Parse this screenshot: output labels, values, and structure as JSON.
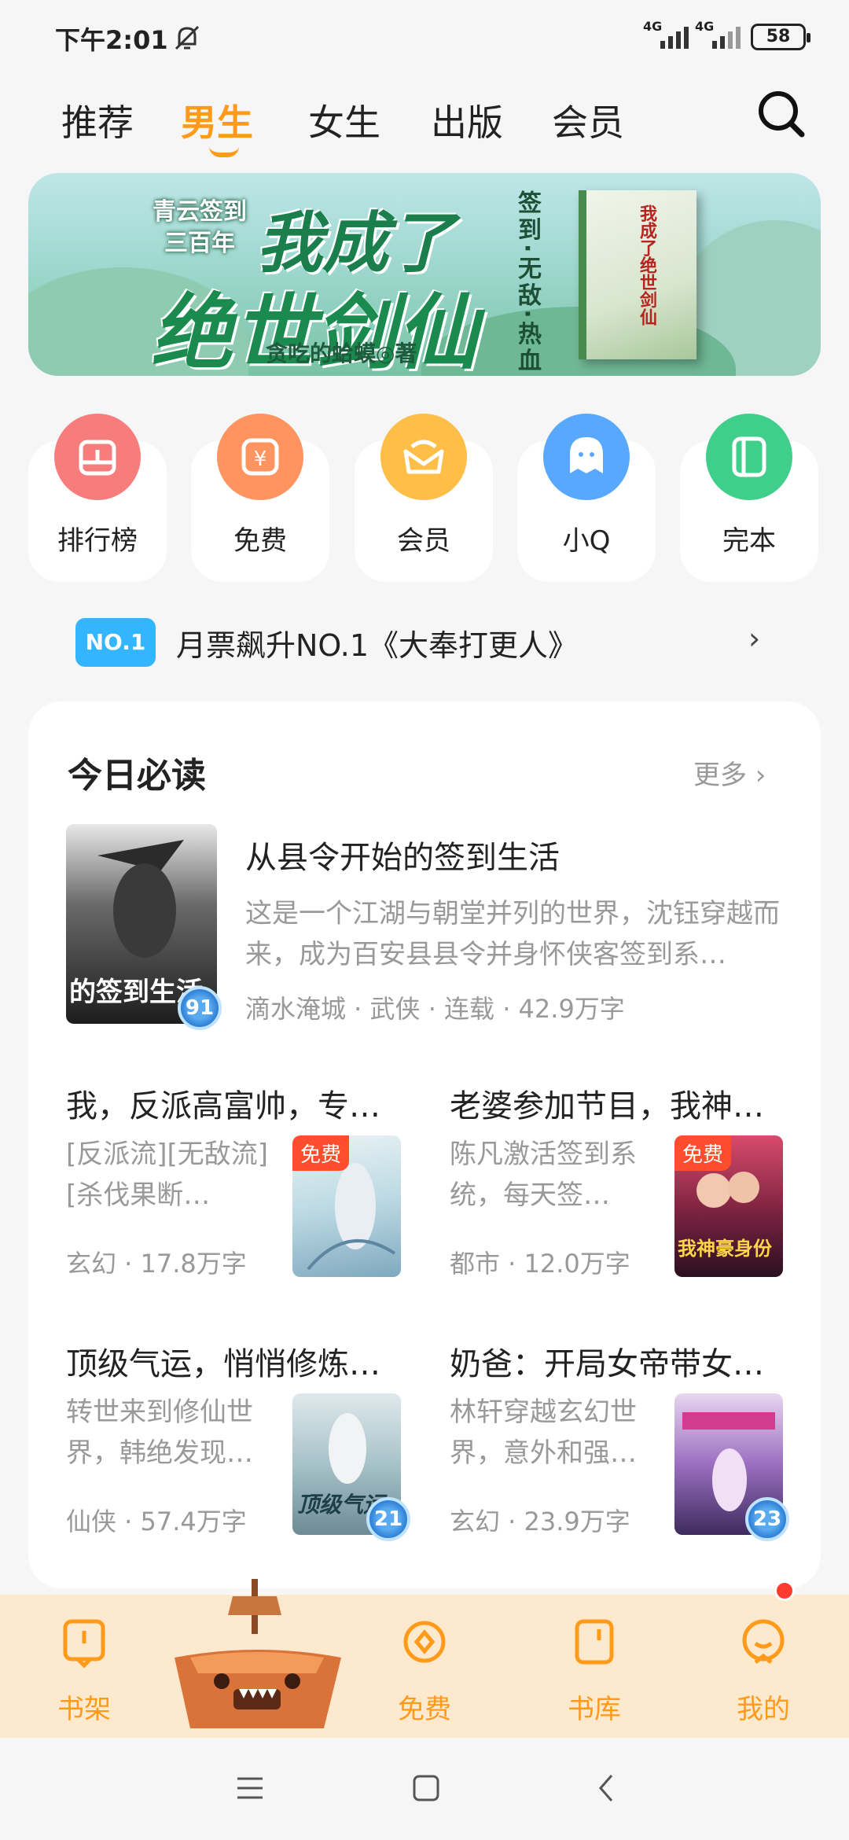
{
  "status_bar": {
    "time": "下午2:01",
    "network_1": "4G",
    "network_2": "4G",
    "battery": "58"
  },
  "tabs": [
    "推荐",
    "男生",
    "女生",
    "出版",
    "会员"
  ],
  "active_tab": "男生",
  "banner": {
    "subtitle": "青云签到三百年",
    "title_1": "我成了",
    "title_2": "绝世剑仙",
    "author": "贪吃的蛤蟆◎著",
    "tags": "签到·无敌·热血",
    "book_cover_title": "我成了绝世剑仙"
  },
  "quick_links": [
    {
      "label": "排行榜",
      "icon": "ranking-icon",
      "color": "#f77d7d"
    },
    {
      "label": "免费",
      "icon": "coin-icon",
      "color": "#ff9460"
    },
    {
      "label": "会员",
      "icon": "crown-icon",
      "color": "#ffbe47"
    },
    {
      "label": "小Q",
      "icon": "ghost-icon",
      "color": "#59a8ff"
    },
    {
      "label": "完本",
      "icon": "book-icon",
      "color": "#3fcf8a"
    }
  ],
  "notice": {
    "badge": "NO.1",
    "text": "月票飙升NO.1《大奉打更人》"
  },
  "section": {
    "title": "今日必读",
    "more": "更多 ›"
  },
  "featured": {
    "title": "从县令开始的签到生活",
    "desc": "这是一个江湖与朝堂并列的世界，沈钰穿越而来，成为百安县县令并身怀侠客签到系…",
    "meta": "滴水淹城 · 武侠 · 连载 · 42.9万字",
    "score": "91",
    "cover_text": "的签到生活"
  },
  "grid_books": [
    {
      "title": "我，反派高富帅，专…",
      "desc": "[反派流][无敌流][杀伐果断…",
      "meta": "玄幻 · 17.8万字",
      "tag": "免费"
    },
    {
      "title": "老婆参加节目，我神…",
      "desc": "陈凡激活签到系统，每天签…",
      "meta": "都市 · 12.0万字",
      "tag": "免费",
      "cover_text": "我神豪身份"
    },
    {
      "title": "顶级气运，悄悄修炼…",
      "desc": "转世来到修仙世界，韩绝发现…",
      "meta": "仙侠 · 57.4万字",
      "score": "21",
      "cover_text": "顶级气运"
    },
    {
      "title": "奶爸：开局女帝带女…",
      "desc": "林轩穿越玄幻世界，意外和强…",
      "meta": "玄幻 · 23.9万字",
      "score": "23"
    }
  ],
  "bottom_nav": [
    {
      "label": "书架",
      "icon": "shelf-icon"
    },
    {
      "label": "免费",
      "icon": "free-icon"
    },
    {
      "label": "书库",
      "icon": "library-icon"
    },
    {
      "label": "我的",
      "icon": "profile-icon"
    }
  ],
  "colors": {
    "accent": "#ff9a1a",
    "notice_blue": "#33b6ff",
    "free_red": "#ff4d2e"
  }
}
